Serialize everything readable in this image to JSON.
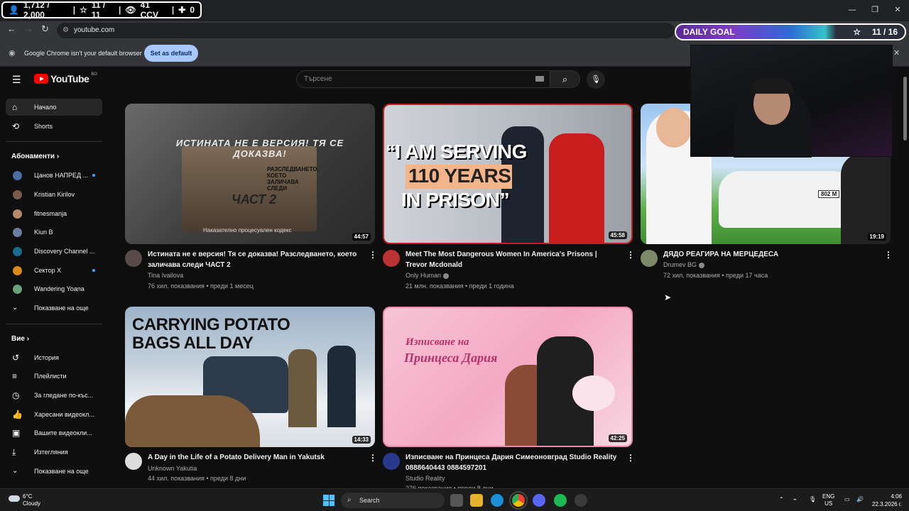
{
  "overlay": {
    "followers": "1,712 / 2,000",
    "stars": "11 / 11",
    "viewers": "41 CCV",
    "plus": "0",
    "daily_goal_label": "DAILY GOAL",
    "daily_goal_count": "11 / 16"
  },
  "browser": {
    "url": "youtube.com",
    "infobar_message": "Google Chrome isn't your default browser",
    "set_default_label": "Set as default"
  },
  "youtube": {
    "logo_text": "YouTube",
    "region": "BG",
    "search_placeholder": "Търсене"
  },
  "sidebar": {
    "home": "Начало",
    "shorts": "Shorts",
    "subscriptions_header": "Абонаменти",
    "subscriptions": [
      {
        "label": "Цанов НАПРЕД ...",
        "color": "#4a6fa5",
        "live": true
      },
      {
        "label": "Kristian Kirilov",
        "color": "#7a5a4a",
        "live": false
      },
      {
        "label": "fitnesmanja",
        "color": "#b58a6a",
        "live": false
      },
      {
        "label": "Kiun B",
        "color": "#6a7fa0",
        "live": false
      },
      {
        "label": "Discovery Channel ...",
        "color": "#1b6b8c",
        "live": false
      },
      {
        "label": "Сектор X",
        "color": "#d98a1a",
        "live": true
      },
      {
        "label": "Wandering Yoana",
        "color": "#6aa07a",
        "live": false
      }
    ],
    "show_more_subs": "Показване на още",
    "you_header": "Вие",
    "you_items": [
      {
        "label": "История",
        "icon": "history-icon"
      },
      {
        "label": "Плейлисти",
        "icon": "playlist-icon"
      },
      {
        "label": "За гледане по-къс...",
        "icon": "watch-later-icon"
      },
      {
        "label": "Харесани видеокл...",
        "icon": "like-icon"
      },
      {
        "label": "Вашите видеокли...",
        "icon": "your-videos-icon"
      },
      {
        "label": "Изтегляния",
        "icon": "download-icon"
      }
    ],
    "show_more_you": "Показване на още"
  },
  "videos": [
    {
      "title": "Истината не е версия! Тя се доказва! Разследването, което заличава следи ЧАСТ 2",
      "channel": "Tina Ivailova",
      "verified": false,
      "meta": "76 хил. показвания • преди 1 месец",
      "duration": "44:57",
      "thumb_caption": "ИСТИНАТА НЕ Е ВЕРСИЯ! ТЯ СЕ ДОКАЗВА!",
      "thumb_sub": "ЧАСТ 2",
      "thumb_footer": "Наказателно процесуален кодекс",
      "thumb_book_text": "РАЗСЛЕДВАНЕТО, КОЕТО ЗАЛИЧАВА СЛЕДИ"
    },
    {
      "title": "Meet The Most Dangerous Women In America's Prisons | Trevor Mcdonald",
      "channel": "Only Human",
      "verified": true,
      "meta": "21 млн. показвания • преди 1 година",
      "duration": "45:58",
      "thumb_line1": "“I AM SERVING",
      "thumb_line2": "110 YEARS",
      "thumb_line3": "IN PRISON”"
    },
    {
      "title": "ДЯДО РЕАГИРА НА МЕРЦЕДЕСА",
      "channel": "Drumev BG",
      "verified": true,
      "meta": "72 хил. показвания • преди 17 часа",
      "duration": "19:19",
      "thumb_plate": "802 M"
    },
    {
      "title": "A Day in the Life of a Potato Delivery Man in Yakutsk",
      "channel": "Unknown Yakutia",
      "verified": false,
      "meta": "44 хил. показвания • преди 8 дни",
      "duration": "14:33",
      "thumb_line1": "CARRYING POTATO",
      "thumb_line2": "BAGS ALL DAY"
    },
    {
      "title": "Изписване на Принцеса Дария Симеоновград Studio Reality 0888640443 0884597201",
      "channel": "Studio Reality",
      "verified": false,
      "meta": "276 показвания • преди 8 дни",
      "duration": "42:25",
      "thumb_line1": "Изписване на",
      "thumb_line2": "Принцеса Дария"
    }
  ],
  "taskbar": {
    "temp": "6°C",
    "weather": "Cloudy",
    "search_label": "Search",
    "lang1": "ENG",
    "lang2": "US",
    "time": "4:06",
    "date": "22.3.2026 г."
  },
  "colors": {
    "accent": "#3ea6ff",
    "youtube_red": "#ff0000",
    "chrome_button": "#a8c7fa"
  }
}
